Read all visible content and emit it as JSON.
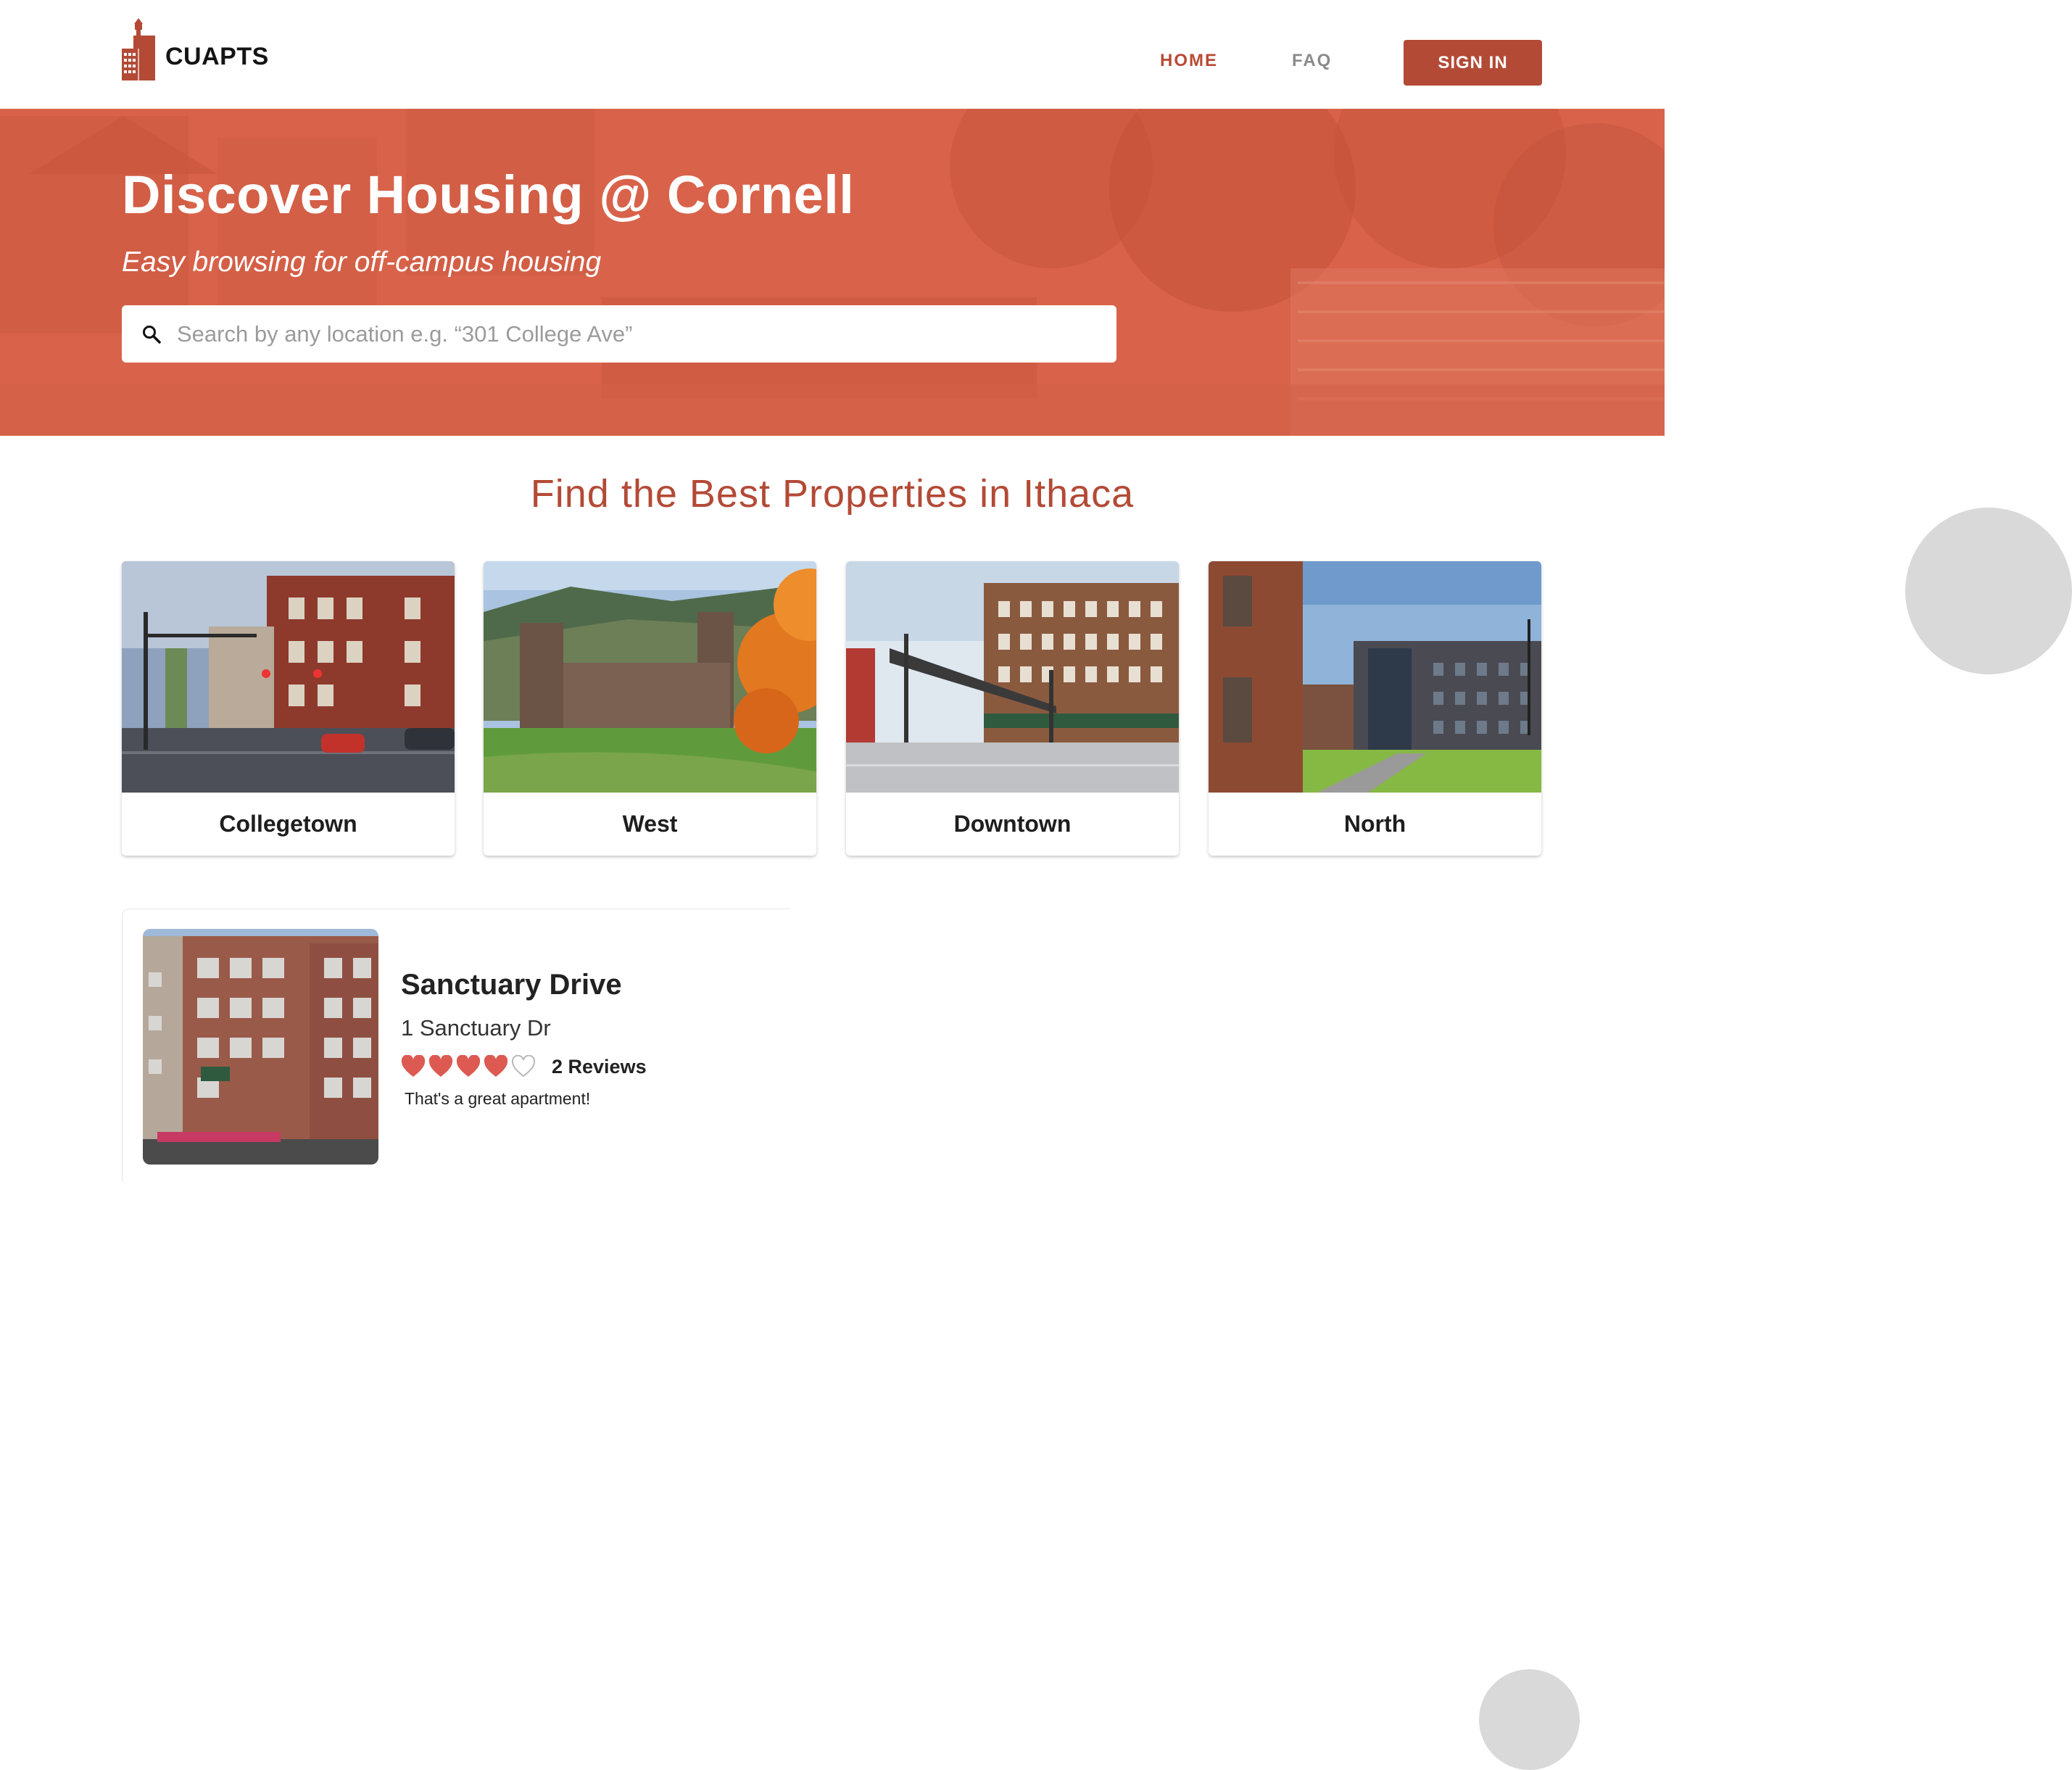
{
  "brand": {
    "name": "CUAPTS",
    "accent": "#b34a36",
    "hero_overlay": "#d8634a"
  },
  "nav": {
    "home": "HOME",
    "faq": "FAQ",
    "sign_in": "SIGN IN"
  },
  "hero": {
    "title": "Discover Housing @ Cornell",
    "subtitle": "Easy browsing for off-campus housing",
    "search_placeholder": "Search by any location e.g. “301 College Ave”",
    "search_value": ""
  },
  "section": {
    "title": "Find the Best Properties in Ithaca"
  },
  "locations": [
    {
      "label": "Collegetown",
      "icon": "street-photo"
    },
    {
      "label": "West",
      "icon": "campus-photo"
    },
    {
      "label": "Downtown",
      "icon": "commons-photo"
    },
    {
      "label": "North",
      "icon": "dorm-photo"
    }
  ],
  "listings": [
    {
      "name": "Sanctuary Drive",
      "address": "1 Sanctuary Dr",
      "rating": 4,
      "rating_max": 5,
      "reviews": "2 Reviews",
      "review_excerpt": "That's a great apartment!"
    }
  ],
  "colors": {
    "heart_filled": "#dc5a52",
    "heart_empty": "#b8b8b8",
    "decor_circle": "#d9d9d9"
  }
}
